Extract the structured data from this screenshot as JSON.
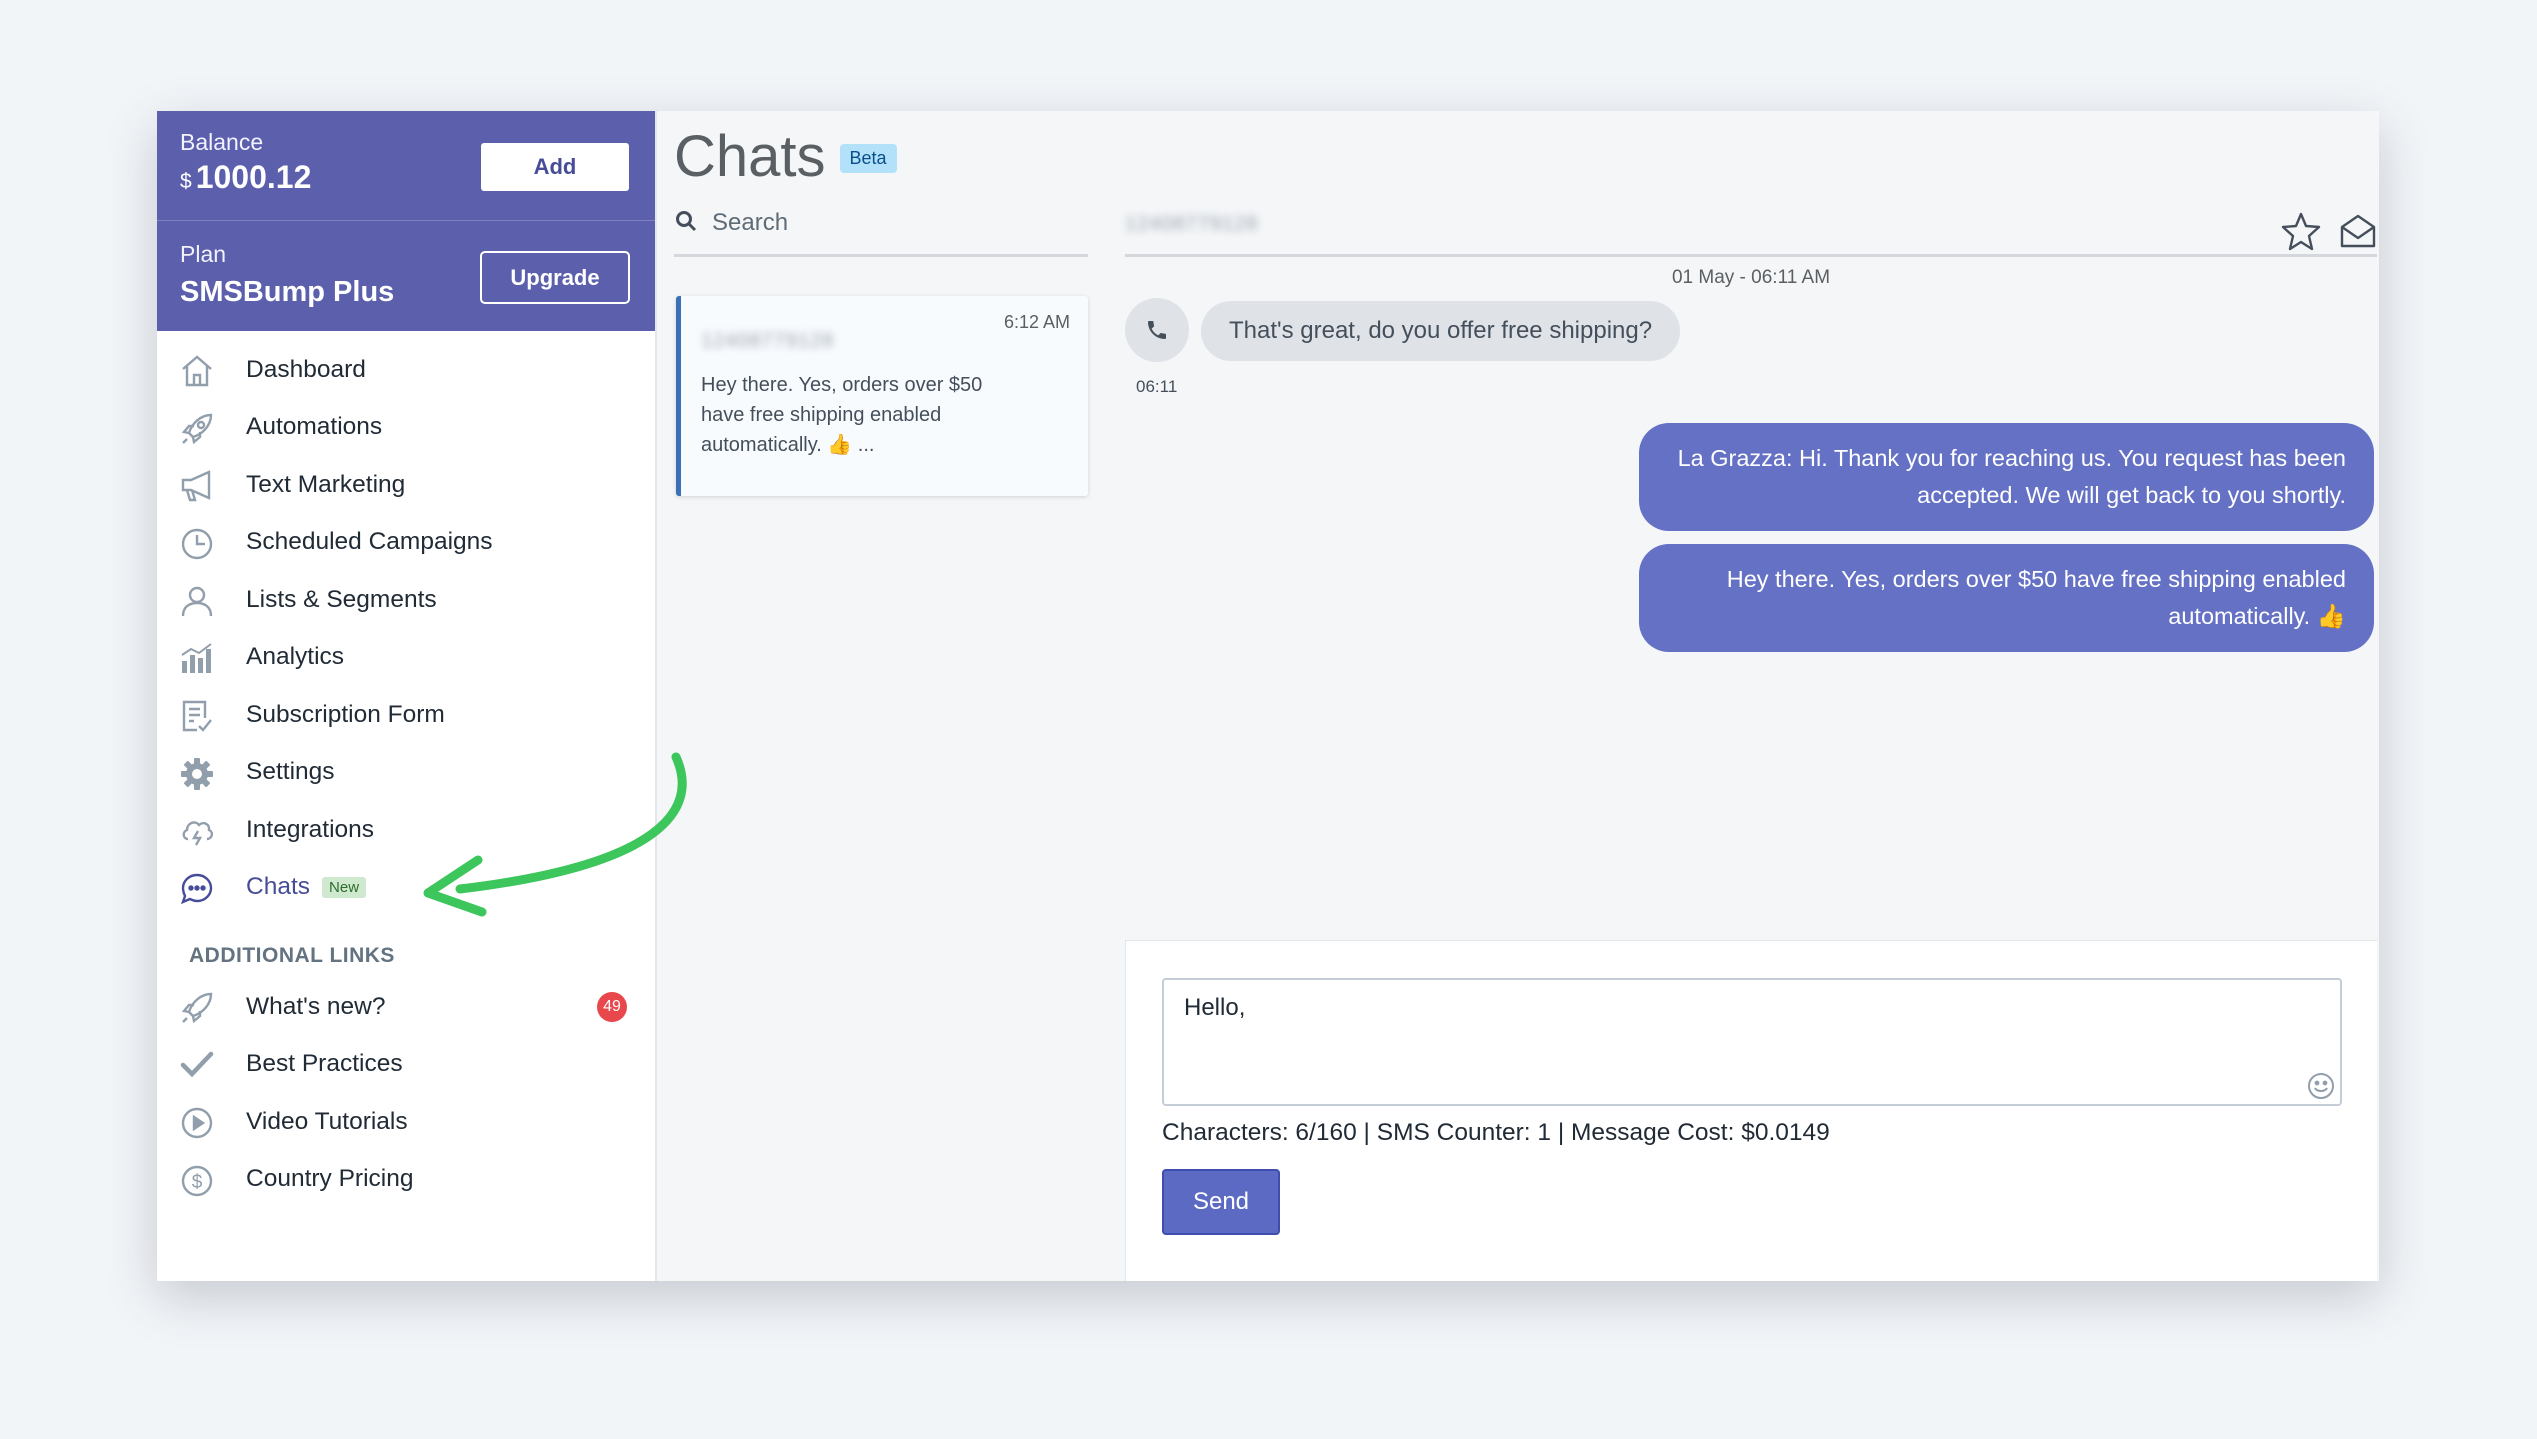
{
  "account": {
    "balance_label": "Balance",
    "currency": "$",
    "balance_value": "1000.12",
    "add_label": "Add",
    "plan_label": "Plan",
    "plan_name": "SMSBump Plus",
    "upgrade_label": "Upgrade"
  },
  "sidebar": {
    "items": [
      {
        "label": "Dashboard",
        "icon": "home-icon"
      },
      {
        "label": "Automations",
        "icon": "rocket-icon"
      },
      {
        "label": "Text Marketing",
        "icon": "megaphone-icon"
      },
      {
        "label": "Scheduled Campaigns",
        "icon": "clock-icon"
      },
      {
        "label": "Lists & Segments",
        "icon": "user-icon"
      },
      {
        "label": "Analytics",
        "icon": "bar-chart-icon"
      },
      {
        "label": "Subscription Form",
        "icon": "form-icon"
      },
      {
        "label": "Settings",
        "icon": "gear-icon"
      },
      {
        "label": "Integrations",
        "icon": "cloud-icon"
      },
      {
        "label": "Chats",
        "icon": "chat-bubble-icon",
        "tag": "New",
        "active": true
      }
    ],
    "additional_title": "ADDITIONAL LINKS",
    "additional": [
      {
        "label": "What's new?",
        "icon": "megaphone-icon",
        "badge": "49"
      },
      {
        "label": "Best Practices",
        "icon": "checkmark-icon"
      },
      {
        "label": "Video Tutorials",
        "icon": "play-icon"
      },
      {
        "label": "Country Pricing",
        "icon": "dollar-icon"
      }
    ]
  },
  "main": {
    "title": "Chats",
    "badge": "Beta",
    "search_placeholder": "Search"
  },
  "conversation": {
    "time": "6:12 AM",
    "phone": "12408779128",
    "preview": "Hey there. Yes, orders over $50 have free shipping enabled automatically. 👍 ..."
  },
  "chat": {
    "phone": "12408779128",
    "date_separator": "01 May - 06:11 AM",
    "incoming": {
      "text": "That's great, do you offer free shipping?",
      "time": "06:11"
    },
    "outgoing": [
      {
        "text": "La Grazza: Hi. Thank you for reaching us. You request has been accepted. We will get back to you shortly."
      },
      {
        "text": "Hey there. Yes, orders over $50 have free shipping enabled automatically. 👍"
      }
    ]
  },
  "composer": {
    "value": "Hello,",
    "stats": "Characters: 6/160 | SMS Counter: 1 | Message Cost: $0.0149",
    "send_label": "Send"
  },
  "colors": {
    "brand_purple": "#5b5fac",
    "bubble_out": "#6471c5",
    "annotation_arrow": "#3cc65b",
    "badge_red": "#e8484c"
  }
}
